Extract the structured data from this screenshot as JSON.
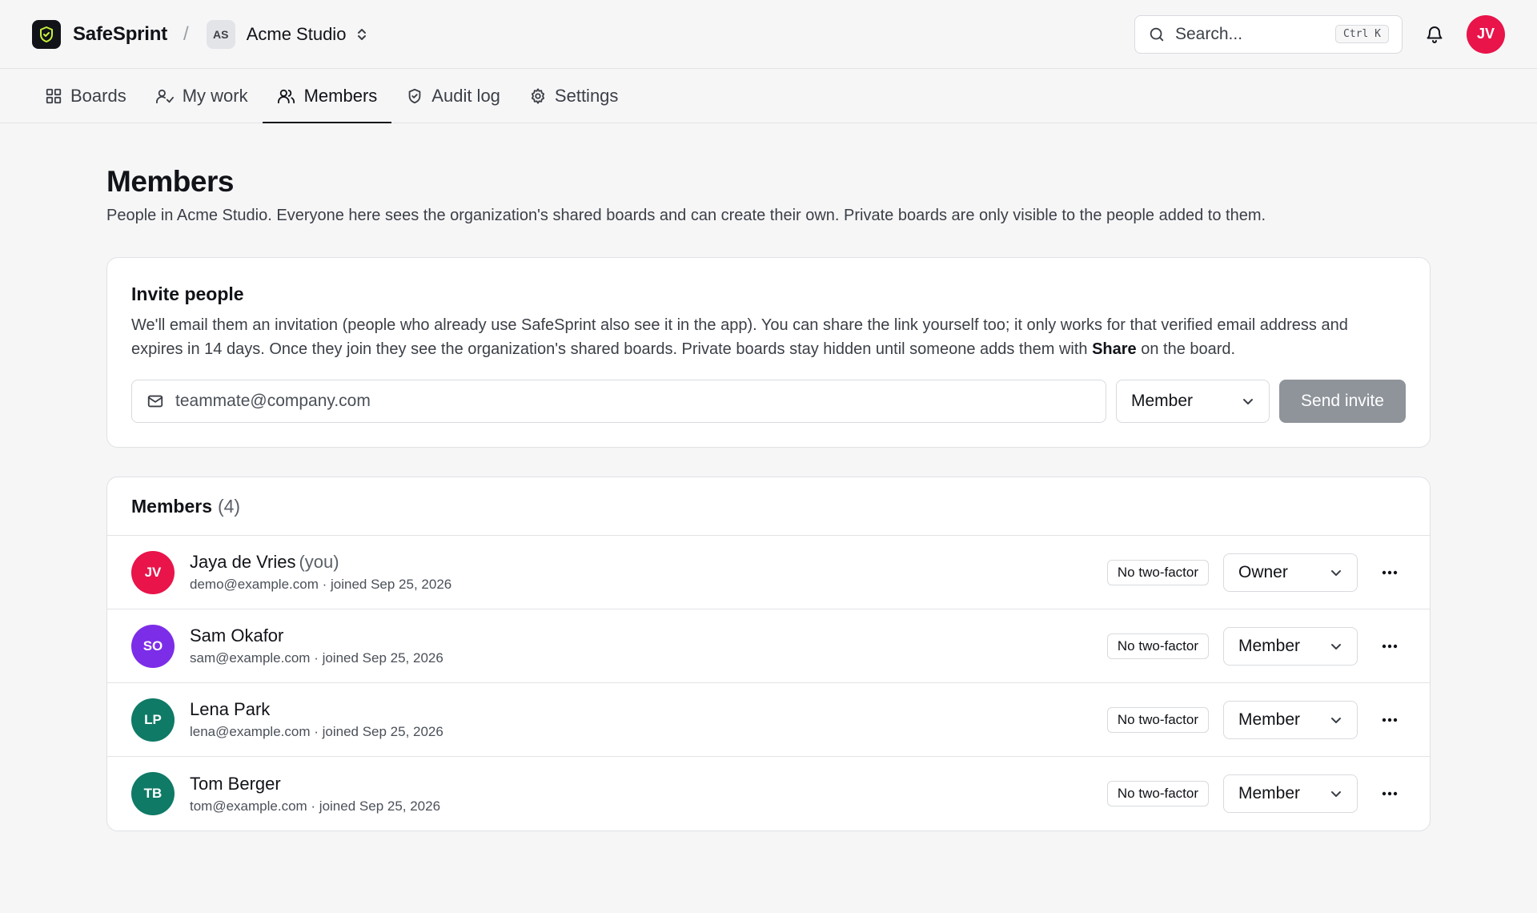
{
  "app": {
    "name": "SafeSprint"
  },
  "org": {
    "initials": "AS",
    "name": "Acme Studio"
  },
  "search": {
    "placeholder": "Search...",
    "shortcut": "Ctrl K"
  },
  "user": {
    "initials": "JV",
    "color": "#e8144a"
  },
  "nav": {
    "tabs": [
      {
        "label": "Boards",
        "icon": "grid-icon"
      },
      {
        "label": "My work",
        "icon": "user-check-icon"
      },
      {
        "label": "Members",
        "icon": "users-icon",
        "active": true
      },
      {
        "label": "Audit log",
        "icon": "shield-check-icon"
      },
      {
        "label": "Settings",
        "icon": "gear-icon"
      }
    ]
  },
  "page": {
    "title": "Members",
    "description": "People in Acme Studio. Everyone here sees the organization's shared boards and can create their own. Private boards are only visible to the people added to them."
  },
  "invite": {
    "title": "Invite people",
    "description_part1": "We'll email them an invitation (people who already use SafeSprint also see it in the app). You can share the link yourself too; it only works for that verified email address and expires in 14 days. Once they join they see the organization's shared boards. Private boards stay hidden until someone adds them with ",
    "description_bold": "Share",
    "description_part2": " on the board.",
    "email_placeholder": "teammate@company.com",
    "role_value": "Member",
    "send_label": "Send invite"
  },
  "members": {
    "title": "Members",
    "count": "(4)",
    "list": [
      {
        "initials": "JV",
        "color": "#e8144a",
        "name": "Jaya de Vries",
        "you": "(you)",
        "meta": "demo@example.com · joined Sep 25, 2026",
        "badge": "No two-factor",
        "role": "Owner"
      },
      {
        "initials": "SO",
        "color": "#7c2de8",
        "name": "Sam Okafor",
        "you": "",
        "meta": "sam@example.com · joined Sep 25, 2026",
        "badge": "No two-factor",
        "role": "Member"
      },
      {
        "initials": "LP",
        "color": "#0f7a66",
        "name": "Lena Park",
        "you": "",
        "meta": "lena@example.com · joined Sep 25, 2026",
        "badge": "No two-factor",
        "role": "Member"
      },
      {
        "initials": "TB",
        "color": "#0f7a66",
        "name": "Tom Berger",
        "you": "",
        "meta": "tom@example.com · joined Sep 25, 2026",
        "badge": "No two-factor",
        "role": "Member"
      }
    ]
  }
}
